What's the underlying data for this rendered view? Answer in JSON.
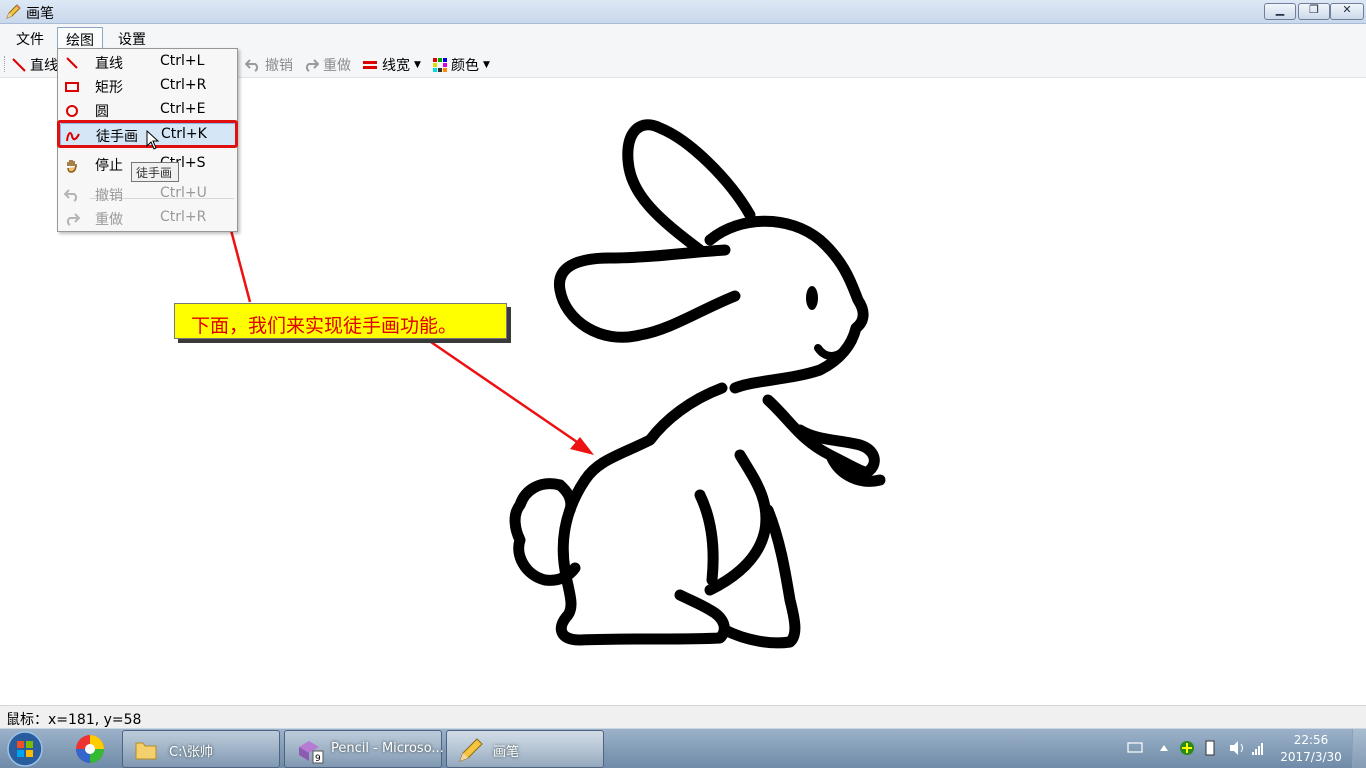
{
  "window": {
    "title": "画笔",
    "min_glyph": "▁",
    "max_glyph": "❐",
    "close_glyph": "✕"
  },
  "menubar": {
    "file": "文件",
    "draw": "绘图",
    "settings": "设置"
  },
  "toolbar": {
    "line": "直线",
    "undo": "撤销",
    "redo": "重做",
    "line_width": "线宽",
    "color": "颜色"
  },
  "draw_menu": {
    "items": [
      {
        "label": "直线",
        "shortcut": "Ctrl+L",
        "icon": "line-icon"
      },
      {
        "label": "矩形",
        "shortcut": "Ctrl+R",
        "icon": "rectangle-icon"
      },
      {
        "label": "圆",
        "shortcut": "Ctrl+E",
        "icon": "circle-icon"
      },
      {
        "label": "徒手画",
        "shortcut": "Ctrl+K",
        "icon": "freehand-icon",
        "highlighted": true
      },
      {
        "label": "停止",
        "shortcut": "Ctrl+S",
        "icon": "hand-icon"
      },
      {
        "label": "撤销",
        "shortcut": "Ctrl+U",
        "icon": "undo-icon",
        "disabled": true
      },
      {
        "label": "重做",
        "shortcut": "Ctrl+R",
        "icon": "redo-icon",
        "disabled": true
      }
    ]
  },
  "tooltip": "徒手画",
  "annotation": {
    "text": "下面，我们来实现徒手画功能。",
    "color": "#e00000",
    "background": "#ffff00"
  },
  "statusbar": {
    "text": "鼠标：x=181, y=58"
  },
  "taskbar": {
    "tasks": [
      {
        "label": "C:\\张帅",
        "icon": "folder-icon"
      },
      {
        "label": "Pencil - Microso...",
        "icon": "visual-studio-icon",
        "badge": "9"
      },
      {
        "label": "画笔",
        "icon": "pencil-icon"
      }
    ],
    "clock_time": "22:56",
    "clock_date": "2017/3/30"
  },
  "colors": {
    "accent_red": "#e01010",
    "menu_highlight": "#d5e6f7"
  }
}
